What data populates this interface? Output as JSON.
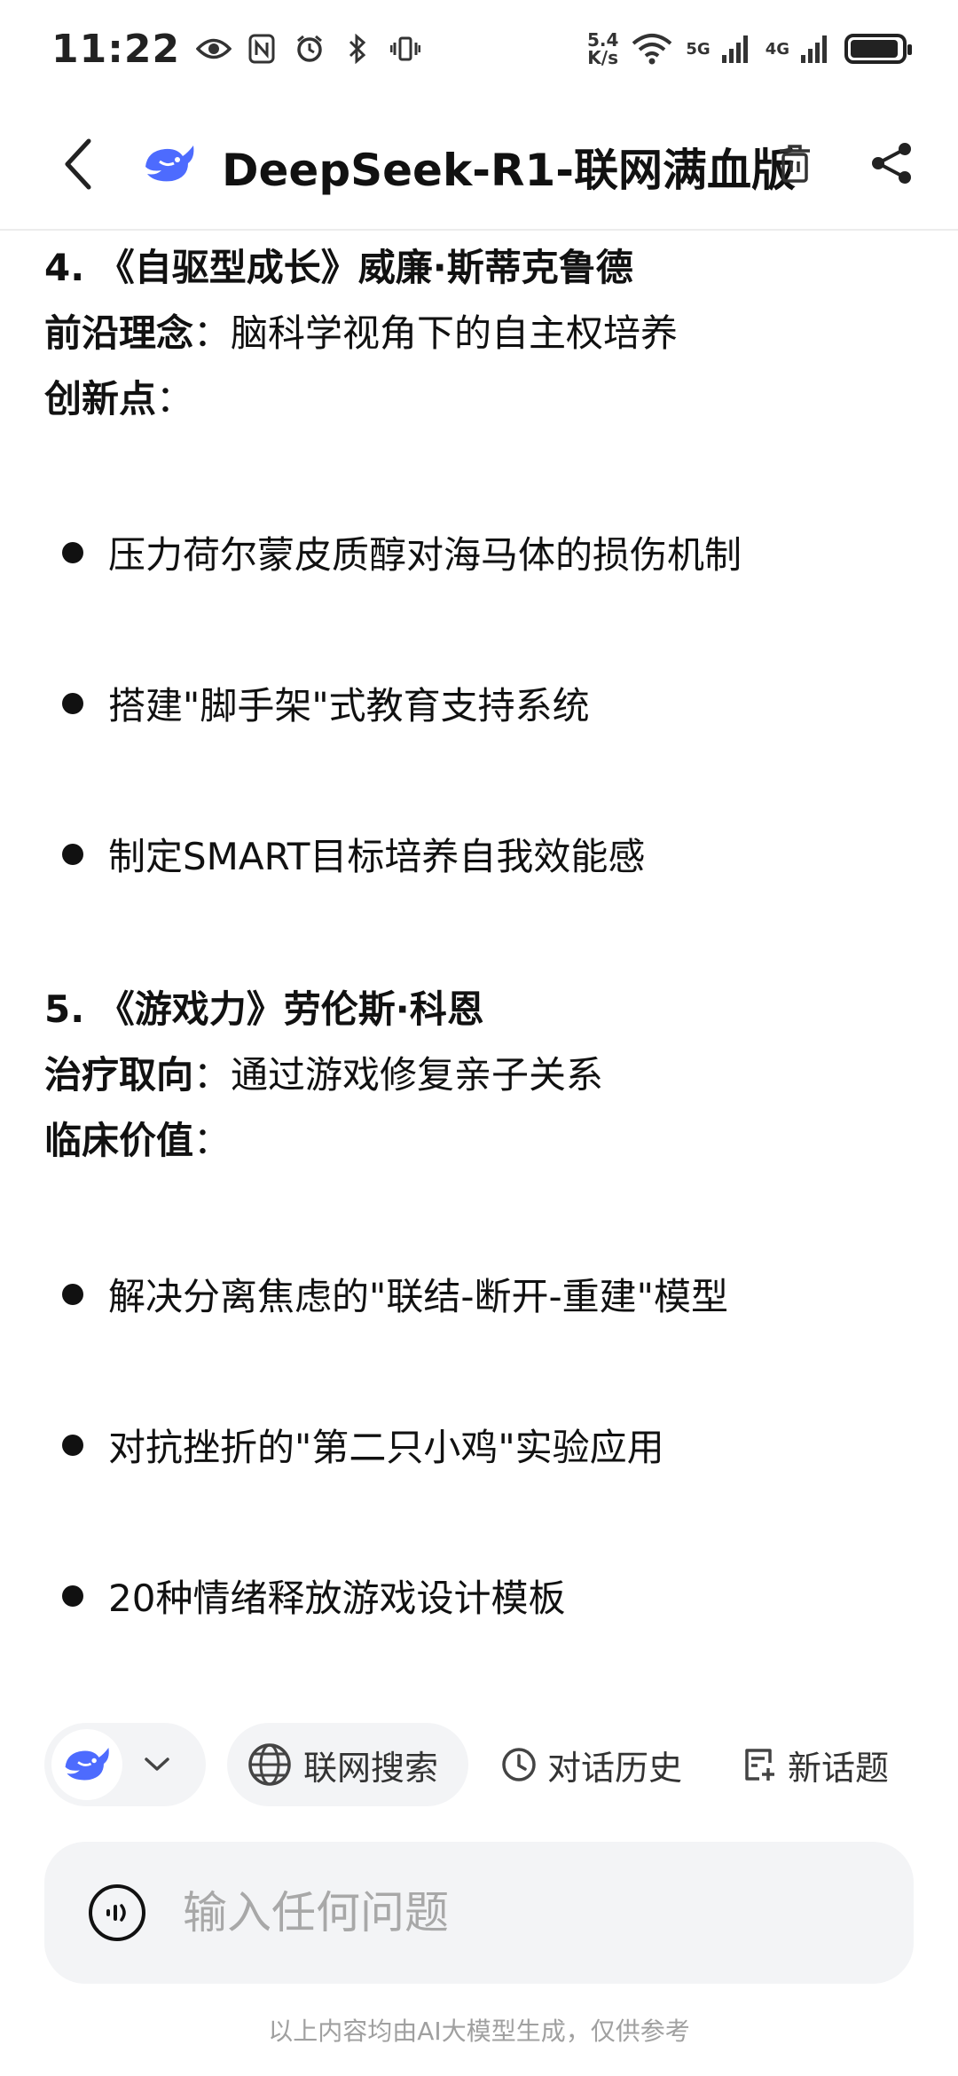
{
  "status_bar": {
    "time": "11:22",
    "net_speed_value": "5.4",
    "net_speed_unit": "K/s",
    "signal_1_label": "5G",
    "signal_2_label": "4G",
    "battery_level": 0.95
  },
  "header": {
    "title": "DeepSeek-R1-联网满血版"
  },
  "content": {
    "section4": {
      "heading": "4. 《自驱型成长》威廉·斯蒂克鲁德",
      "concept_label": "前沿理念",
      "concept_text": "：脑科学视角下的自主权培养",
      "innovation_label": "创新点",
      "innovation_colon": "：",
      "bullets": [
        "压力荷尔蒙皮质醇对海马体的损伤机制",
        "搭建\"脚手架\"式教育支持系统",
        "制定SMART目标培养自我效能感"
      ]
    },
    "section5": {
      "heading": "5. 《游戏力》劳伦斯·科恩",
      "approach_label": "治疗取向",
      "approach_text": "：通过游戏修复亲子关系",
      "value_label": "临床价值",
      "value_colon": "：",
      "bullets": [
        "解决分离焦虑的\"联结-断开-重建\"模型",
        "对抗挫折的\"第二只小鸡\"实验应用",
        "20种情绪释放游戏设计模板"
      ]
    }
  },
  "toolbar": {
    "web_search_label": "联网搜索",
    "history_label": "对话历史",
    "new_topic_label": "新话题"
  },
  "input": {
    "placeholder": "输入任何问题"
  },
  "footer": {
    "disclaimer": "以上内容均由AI大模型生成，仅供参考"
  },
  "colors": {
    "brand_blue": "#4D6BFE",
    "chip_bg": "#f3f4f6",
    "text": "#111111",
    "muted": "#a0a0a0"
  }
}
